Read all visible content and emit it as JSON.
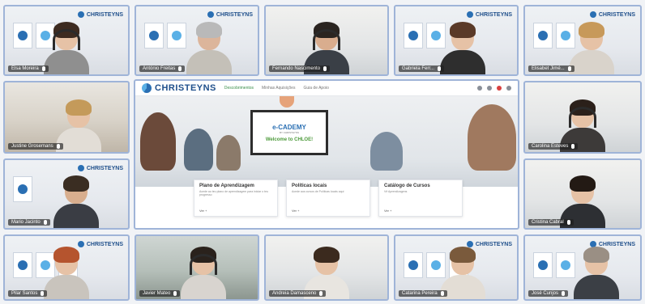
{
  "participants": [
    {
      "name": "Elsa Moreira"
    },
    {
      "name": "António Freitas"
    },
    {
      "name": "Fernando Nascimento"
    },
    {
      "name": "Gabriela Ferr..."
    },
    {
      "name": "Elisabet Jimé..."
    },
    {
      "name": "Justine Grosemans"
    },
    {
      "name": "Carolina Esteves"
    },
    {
      "name": "Mario Jacinto"
    },
    {
      "name": "Cristina Cabral"
    },
    {
      "name": "Pilar Santos"
    },
    {
      "name": "Javier Mateo"
    },
    {
      "name": "Andreia Damasceno"
    },
    {
      "name": "Catarina Pereira"
    },
    {
      "name": "José Cunjos"
    }
  ],
  "main_screen": {
    "brand": "CHRISTEYNS",
    "nav": [
      "Descobrimentos",
      "Minhas Aquisições",
      "Guia de Apoio"
    ],
    "screen_title": "e-CADEMY",
    "screen_sub": "BY CHRISTEYNS",
    "screen_welcome": "Welcome to CHLOE!",
    "panels": [
      {
        "title": "Plano de Aprendizagem",
        "desc": "Acede ao teu plano de aprendizagem para iniciar o teu progresso",
        "more": "Ver +"
      },
      {
        "title": "Políticas locais",
        "desc": "Acede aos cursos de Políticas locais aqui",
        "more": "Ver +"
      },
      {
        "title": "Catálogo de Cursos",
        "desc": "Vê Aprendizagens",
        "more": "Ver +"
      }
    ]
  },
  "poster_logo": "CHRISTEYNS",
  "poster_card_colors": [
    "#2a6fb3",
    "#5ab0e6",
    "#4c9a3a",
    "#8a4f9e"
  ],
  "colors": {
    "frame": "#9fb4d8",
    "brand_blue": "#1f4f8b",
    "accent_green": "#4c9a3a"
  }
}
